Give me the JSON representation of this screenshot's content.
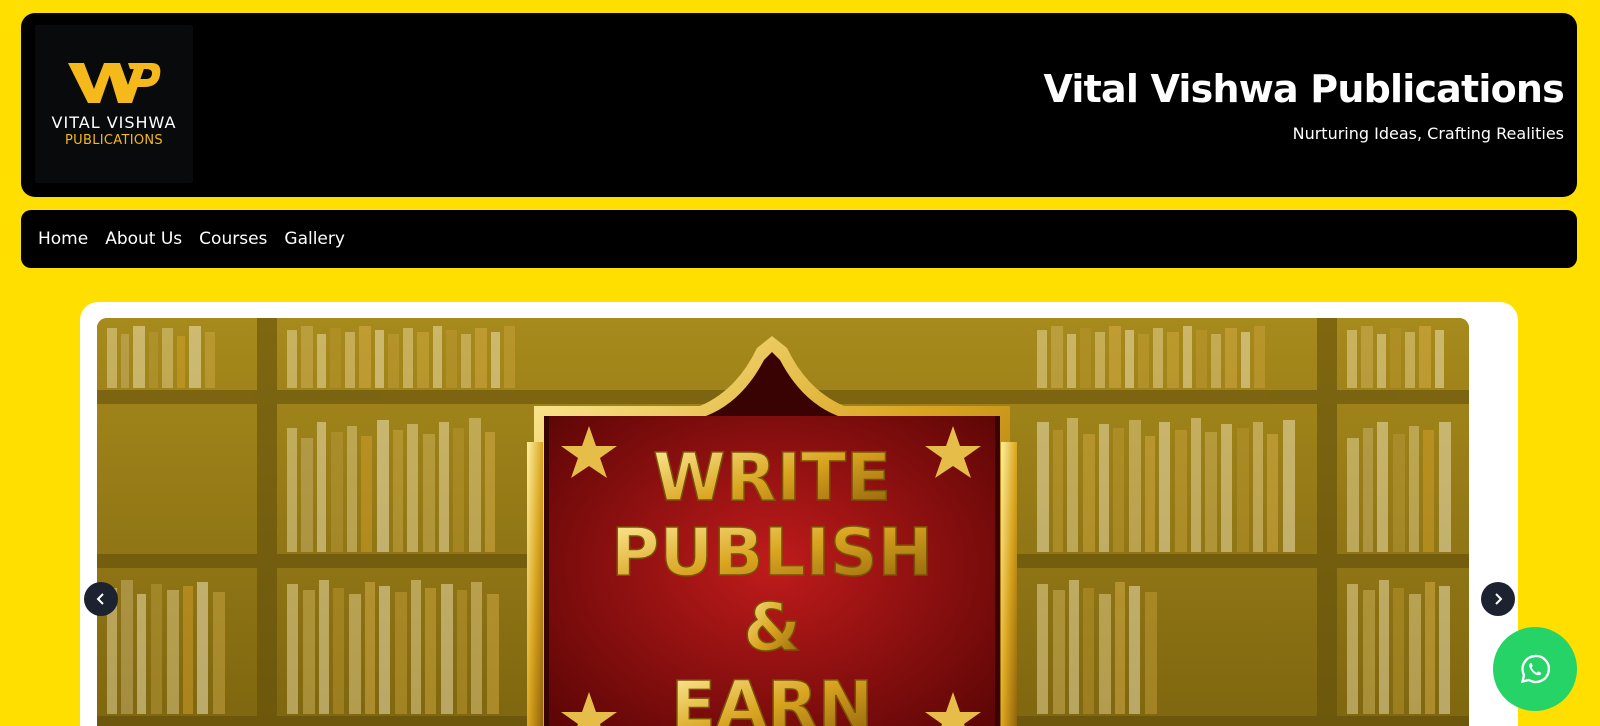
{
  "header": {
    "logo": {
      "mark": "WP",
      "name": "VITAL VISHWA",
      "sub": "PUBLICATIONS"
    },
    "title": "Vital Vishwa Publications",
    "tagline": "Nurturing Ideas, Crafting Realities"
  },
  "nav": {
    "items": [
      {
        "label": "Home"
      },
      {
        "label": "About Us"
      },
      {
        "label": "Courses"
      },
      {
        "label": "Gallery"
      }
    ]
  },
  "slider": {
    "slide_text": [
      "WRITE",
      "PUBLISH",
      "&",
      "EARN"
    ],
    "prev_icon": "chevron-left-icon",
    "next_icon": "chevron-right-icon"
  },
  "floating": {
    "icon": "whatsapp-icon"
  },
  "colors": {
    "page_bg": "#ffdf00",
    "header_bg": "#000000",
    "logo_gold": "#f5b91c",
    "whatsapp": "#25d366",
    "arrow_bg": "#1c2230"
  }
}
